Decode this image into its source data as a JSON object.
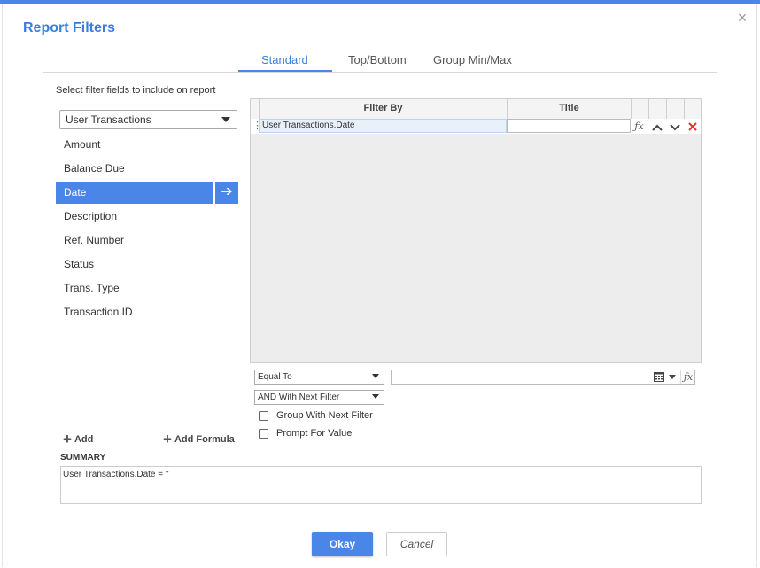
{
  "dialog": {
    "title": "Report Filters",
    "close_glyph": "×"
  },
  "tabs": [
    {
      "label": "Standard",
      "active": true
    },
    {
      "label": "Top/Bottom",
      "active": false
    },
    {
      "label": "Group Min/Max",
      "active": false
    }
  ],
  "left_panel": {
    "instruction": "Select filter fields to include on report",
    "source_select": "User Transactions",
    "fields": [
      "Amount",
      "Balance Due",
      "Date",
      "Description",
      "Ref. Number",
      "Status",
      "Trans. Type",
      "Transaction ID"
    ],
    "selected_field": "Date",
    "move_glyph": "➔",
    "add_label": "Add",
    "add_formula_label": "Add Formula"
  },
  "grid": {
    "headers": {
      "filter_by": "Filter By",
      "title": "Title"
    },
    "rows": [
      {
        "filter_by": "User Transactions.Date",
        "title": ""
      }
    ],
    "icons": {
      "formula": "fx",
      "up": "chevron-up-icon",
      "down": "chevron-down-icon",
      "delete": "delete-icon"
    }
  },
  "condition": {
    "operator": "Equal To",
    "value": "",
    "join": "AND With Next Filter",
    "group_with_next_label": "Group With Next Filter",
    "group_with_next_checked": false,
    "prompt_for_value_label": "Prompt For Value",
    "prompt_for_value_checked": false
  },
  "summary": {
    "label": "SUMMARY",
    "text": "User Transactions.Date = ''"
  },
  "buttons": {
    "okay": "Okay",
    "cancel": "Cancel"
  },
  "colors": {
    "accent": "#4a86e8",
    "title": "#3b7ddd",
    "delete": "#e0322e"
  }
}
